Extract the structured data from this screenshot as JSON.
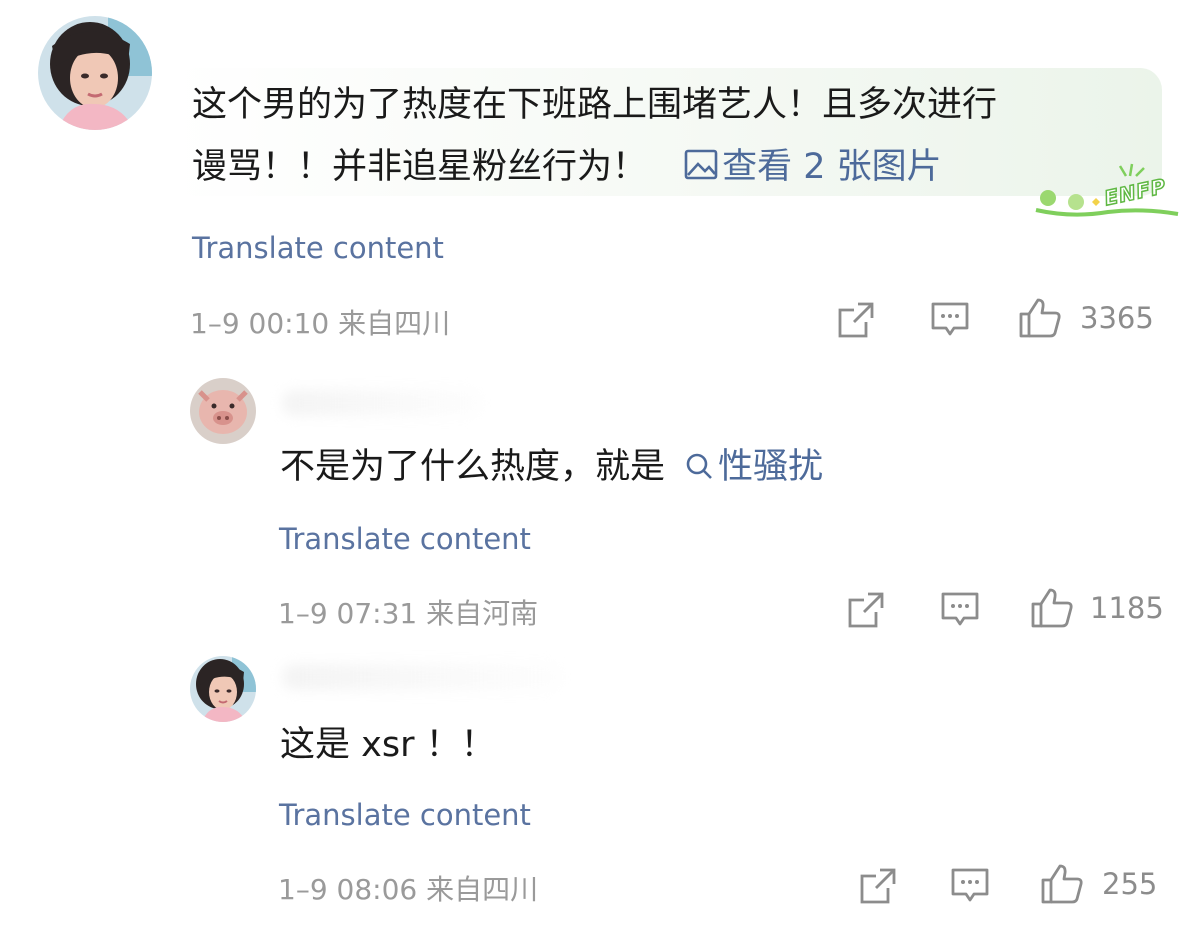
{
  "comments": [
    {
      "line1": "这个男的为了热度在下班路上围堵艺人！且多次进行",
      "line2": "谩骂！！并非追星粉丝行为！",
      "image_link": "查看 2 张图片",
      "image_link_icon": "image-icon",
      "badge_text": "ENFP",
      "translate": "Translate content",
      "meta": "1–9 00:10 来自四川",
      "likes": "3365"
    },
    {
      "text": "不是为了什么热度，就是",
      "search_link": "性骚扰",
      "search_link_icon": "search-icon",
      "translate": "Translate content",
      "meta": "1–9 07:31 来自河南",
      "likes": "1185"
    },
    {
      "text": "这是 xsr ！！",
      "translate": "Translate content",
      "meta": "1–9 08:06 来自四川",
      "likes": "255"
    }
  ],
  "colors": {
    "link": "#4d6a9a",
    "translate": "#5a73a0",
    "meta": "#9a9a9a",
    "icon": "#8c8c8c"
  }
}
